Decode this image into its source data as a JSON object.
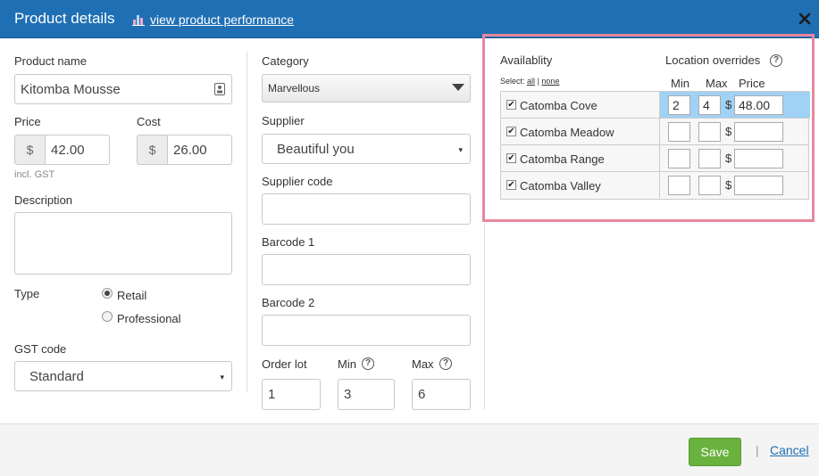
{
  "header": {
    "title": "Product details",
    "performance_link": "view product performance"
  },
  "form": {
    "product_name_label": "Product name",
    "product_name_value": "Kitomba Mousse",
    "price_label": "Price",
    "price_prefix": "$",
    "price_value": "42.00",
    "price_note": "incl. GST",
    "cost_label": "Cost",
    "cost_prefix": "$",
    "cost_value": "26.00",
    "description_label": "Description",
    "description_value": "",
    "type_label": "Type",
    "type_options": [
      "Retail",
      "Professional"
    ],
    "type_selected": "Retail",
    "gst_label": "GST code",
    "gst_value": "Standard",
    "category_label": "Category",
    "category_value": "Marvellous",
    "supplier_label": "Supplier",
    "supplier_value": "Beautiful you",
    "supplier_code_label": "Supplier code",
    "supplier_code_value": "",
    "barcode1_label": "Barcode 1",
    "barcode1_value": "",
    "barcode2_label": "Barcode 2",
    "barcode2_value": "",
    "order_lot_label": "Order lot",
    "order_lot_value": "1",
    "min_label": "Min",
    "min_value": "3",
    "max_label": "Max",
    "max_value": "6"
  },
  "availability": {
    "title": "Availablity",
    "overrides_title": "Location overrides",
    "select_prefix": "Select:",
    "select_all": "all",
    "select_sep": "|",
    "select_none": "none",
    "col_min": "Min",
    "col_max": "Max",
    "col_price": "Price",
    "currency": "$",
    "locations": [
      {
        "name": "Catomba Cove",
        "checked": true,
        "min": "2",
        "max": "4",
        "price": "48.00"
      },
      {
        "name": "Catomba Meadow",
        "checked": true,
        "min": "",
        "max": "",
        "price": ""
      },
      {
        "name": "Catomba Range",
        "checked": true,
        "min": "",
        "max": "",
        "price": ""
      },
      {
        "name": "Catomba Valley",
        "checked": true,
        "min": "",
        "max": "",
        "price": ""
      }
    ]
  },
  "footer": {
    "save_label": "Save",
    "separator": "|",
    "cancel_label": "Cancel"
  },
  "icons": {
    "checkmark": "✔",
    "help": "?",
    "caret": "▾"
  },
  "colors": {
    "header_bg": "#1f6fb4",
    "save_bg": "#6ab23e",
    "highlight_border": "#e8879e",
    "active_row": "#9fd2f5"
  }
}
